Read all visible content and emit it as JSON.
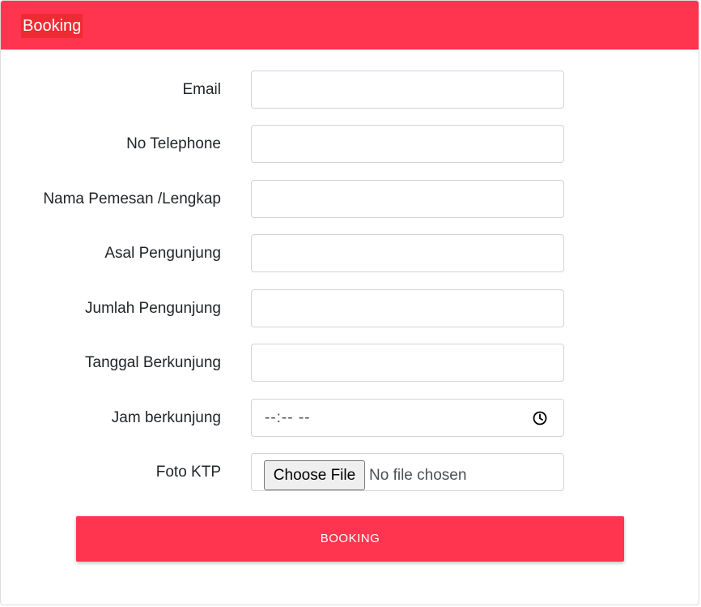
{
  "header": {
    "title": "Booking"
  },
  "form": {
    "fields": [
      {
        "label": "Email",
        "value": ""
      },
      {
        "label": "No Telephone",
        "value": ""
      },
      {
        "label": "Nama Pemesan /Lengkap",
        "value": ""
      },
      {
        "label": "Asal Pengunjung",
        "value": ""
      },
      {
        "label": "Jumlah Pengunjung",
        "value": ""
      },
      {
        "label": "Tanggal Berkunjung",
        "value": ""
      }
    ],
    "time": {
      "label": "Jam berkunjung",
      "value": "--:-- --",
      "icon": "clock-icon"
    },
    "file": {
      "label": "Foto KTP",
      "button_label": "Choose File",
      "status": "No file chosen"
    },
    "submit_label": "BOOKING"
  },
  "colors": {
    "accent": "#ff344f",
    "title_highlight": "#ee2a33",
    "text": "#212529"
  }
}
